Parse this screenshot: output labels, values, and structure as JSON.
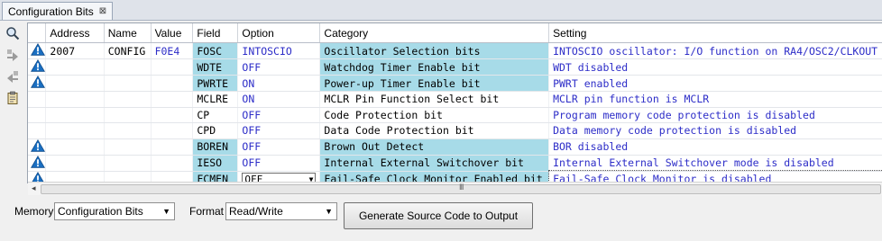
{
  "tab": {
    "title": "Configuration Bits",
    "close_glyph": "⊠"
  },
  "columns": [
    "Address",
    "Name",
    "Value",
    "Field",
    "Option",
    "Category",
    "Setting"
  ],
  "rows": [
    {
      "warn": true,
      "address": "2007",
      "name": "CONFIG",
      "value": "F0E4",
      "field": "FOSC",
      "option": "INTOSCIO",
      "category": "Oscillator Selection bits",
      "setting": "INTOSCIO oscillator: I/O function on RA4/OSC2/CLKOUT",
      "highlight": true
    },
    {
      "warn": true,
      "address": "",
      "name": "",
      "value": "",
      "field": "WDTE",
      "option": "OFF",
      "category": "Watchdog Timer Enable bit",
      "setting": "WDT disabled",
      "highlight": true
    },
    {
      "warn": true,
      "address": "",
      "name": "",
      "value": "",
      "field": "PWRTE",
      "option": "ON",
      "category": "Power-up Timer Enable bit",
      "setting": "PWRT enabled",
      "highlight": true
    },
    {
      "warn": false,
      "address": "",
      "name": "",
      "value": "",
      "field": "MCLRE",
      "option": "ON",
      "category": "MCLR Pin Function Select bit",
      "setting": "MCLR pin function is MCLR",
      "highlight": false
    },
    {
      "warn": false,
      "address": "",
      "name": "",
      "value": "",
      "field": "CP",
      "option": "OFF",
      "category": "Code Protection bit",
      "setting": "Program memory code protection is disabled",
      "highlight": false
    },
    {
      "warn": false,
      "address": "",
      "name": "",
      "value": "",
      "field": "CPD",
      "option": "OFF",
      "category": "Data Code Protection bit",
      "setting": "Data memory code protection is disabled",
      "highlight": false
    },
    {
      "warn": true,
      "address": "",
      "name": "",
      "value": "",
      "field": "BOREN",
      "option": "OFF",
      "category": "Brown Out Detect",
      "setting": "BOR disabled",
      "highlight": true
    },
    {
      "warn": true,
      "address": "",
      "name": "",
      "value": "",
      "field": "IESO",
      "option": "OFF",
      "category": "Internal External Switchover bit",
      "setting": "Internal External Switchover mode is disabled",
      "highlight": true
    },
    {
      "warn": true,
      "address": "",
      "name": "",
      "value": "",
      "field": "FCMEN",
      "option": "OFF",
      "category": "Fail-Safe Clock Monitor Enabled bit",
      "setting": "Fail-Safe Clock Monitor is disabled",
      "highlight": true,
      "editing": true
    }
  ],
  "scroll_grip": "III",
  "bottom": {
    "memory_label": "Memory",
    "memory_value": "Configuration Bits",
    "format_label": "Format",
    "format_value": "Read/Write",
    "generate_label": "Generate Source Code to Output"
  },
  "colors": {
    "highlight": "#a7dbe8",
    "value_text": "#2d2dc8",
    "warning": "#1a6fc2"
  }
}
